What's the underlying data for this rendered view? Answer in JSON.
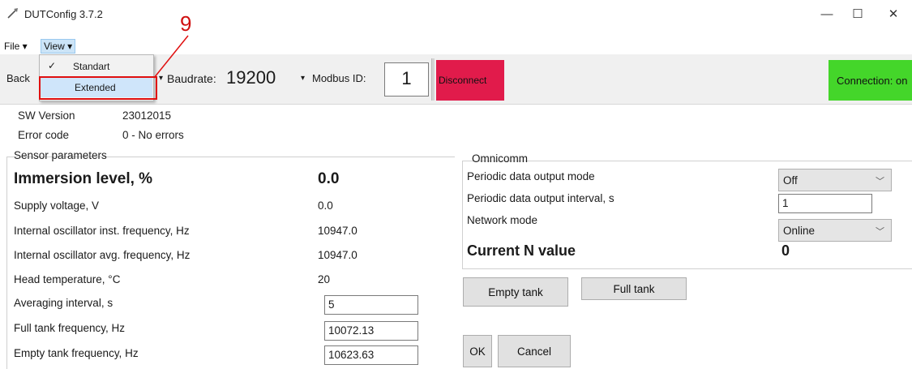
{
  "window": {
    "title": "DUTConfig 3.7.2",
    "minimize_glyph": "—",
    "maximize_glyph": "☐",
    "close_glyph": "✕"
  },
  "menubar": {
    "file": "File ▾",
    "view": "View ▾"
  },
  "view_menu": {
    "check_glyph": "✓",
    "items": [
      "Standart",
      "Extended"
    ],
    "checked": "Standart",
    "highlighted": "Extended"
  },
  "toolbar": {
    "back_label": "Back",
    "baud_caret": "▾",
    "baudrate_label": "Baudrate:",
    "baudrate_value": "19200",
    "baud_dropdown_glyph": "▾",
    "modbus_label": "Modbus ID:",
    "modbus_value": "1",
    "disconnect_label": "Disconnect",
    "connection_label": "Connection: on",
    "colors": {
      "disconnect": "#e11b4b",
      "connection": "#44d62a"
    }
  },
  "annotation": {
    "number": "9",
    "color": "#e01010"
  },
  "info": {
    "sw_version_label": "SW Version",
    "sw_version_value": "23012015",
    "error_code_label": "Error code",
    "error_code_value": "0 - No errors"
  },
  "sensor": {
    "legend": "Sensor parameters",
    "immersion_label": "Immersion level, %",
    "immersion_value": "0.0",
    "rows": [
      {
        "label": "Supply voltage, V",
        "value": "0.0"
      },
      {
        "label": "Internal oscillator inst. frequency, Hz",
        "value": "10947.0"
      },
      {
        "label": "Internal oscillator avg. frequency, Hz",
        "value": "10947.0"
      },
      {
        "label": "Head temperature, °C",
        "value": "20"
      }
    ],
    "averaging_label": "Averaging interval, s",
    "averaging_value": "5",
    "full_tank_label": "Full tank frequency, Hz",
    "full_tank_value": "10072.13",
    "empty_tank_label": "Empty tank frequency, Hz",
    "empty_tank_value": "10623.63"
  },
  "omnicomm": {
    "legend": "Omnicomm",
    "periodic_mode_label": "Periodic data output mode",
    "periodic_mode_value": "Off",
    "periodic_interval_label": "Periodic data output interval, s",
    "periodic_interval_value": "1",
    "network_mode_label": "Network mode",
    "network_mode_value": "Online",
    "current_n_label": "Current N value",
    "current_n_value": "0",
    "dropdown_glyph": "﹀"
  },
  "buttons": {
    "empty_tank": "Empty tank",
    "full_tank": "Full tank",
    "ok": "OK",
    "cancel": "Cancel"
  }
}
